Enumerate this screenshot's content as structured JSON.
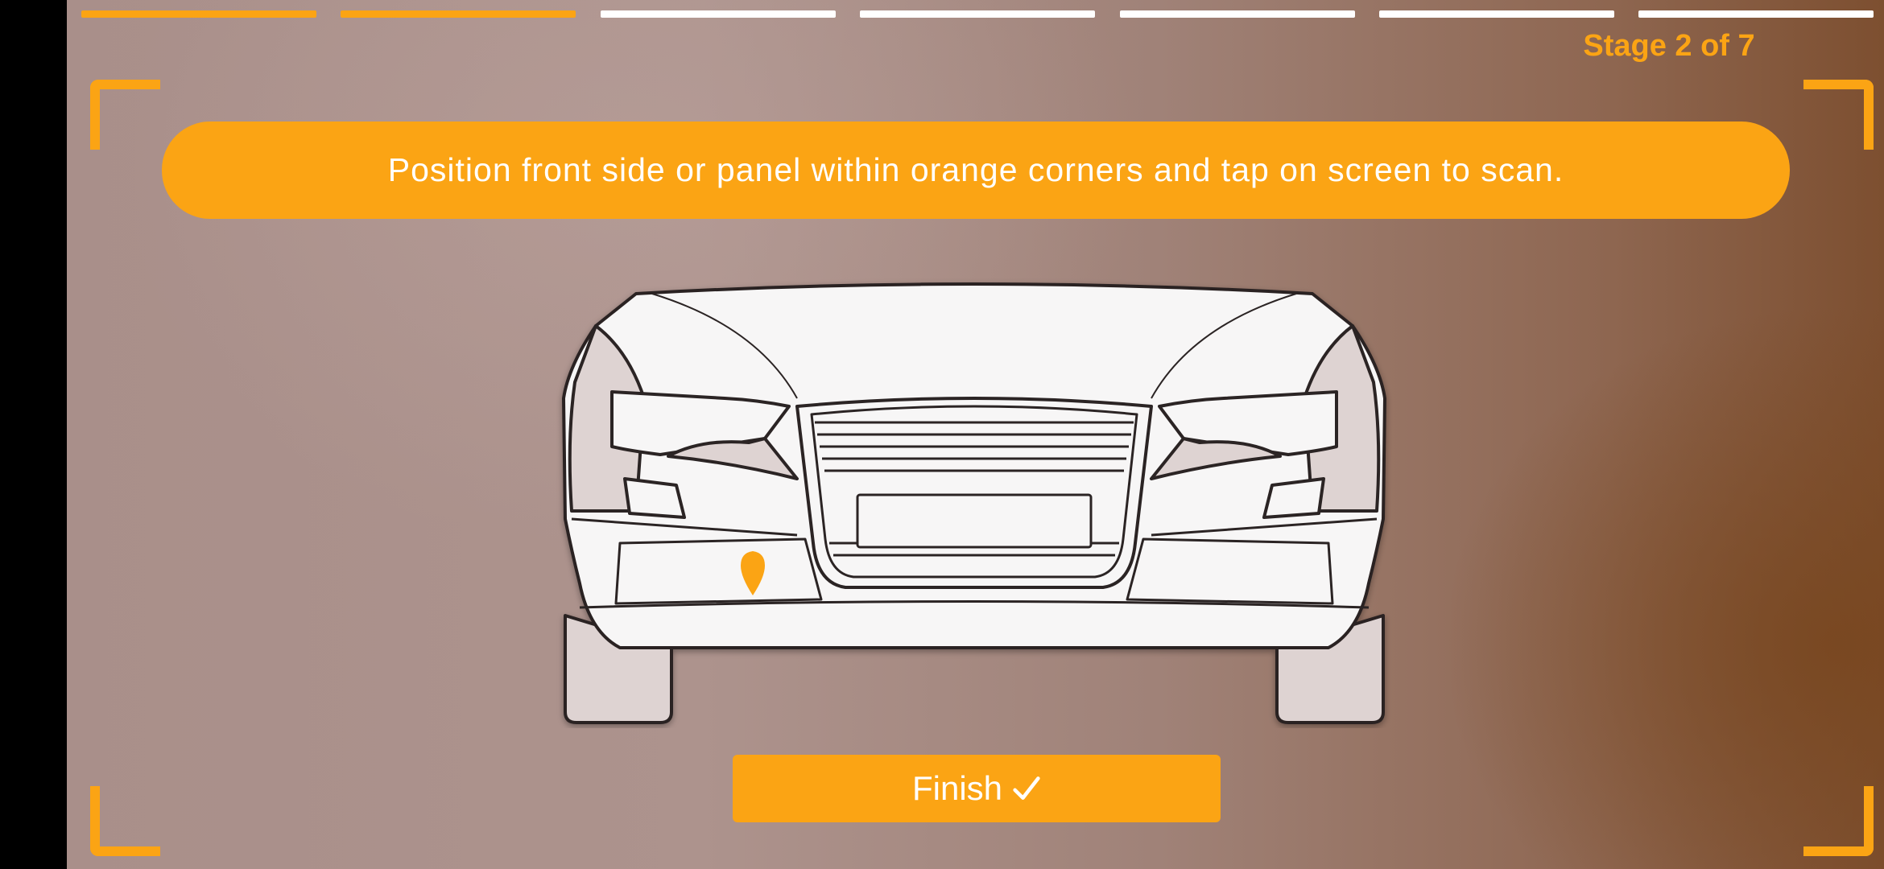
{
  "stage": {
    "label": "Stage 2 of 7",
    "current": 2,
    "total": 7
  },
  "instruction": "Position front side or panel within orange corners and tap on screen to scan.",
  "finish_button": {
    "label": "Finish",
    "icon": "checkmark-icon"
  },
  "car_diagram": {
    "view": "front",
    "marker_icon": "location-pin-icon"
  },
  "colors": {
    "accent": "#fba414",
    "progress_done": "#fba414",
    "progress_todo": "#ffffff",
    "text_on_accent": "#ffffff"
  }
}
